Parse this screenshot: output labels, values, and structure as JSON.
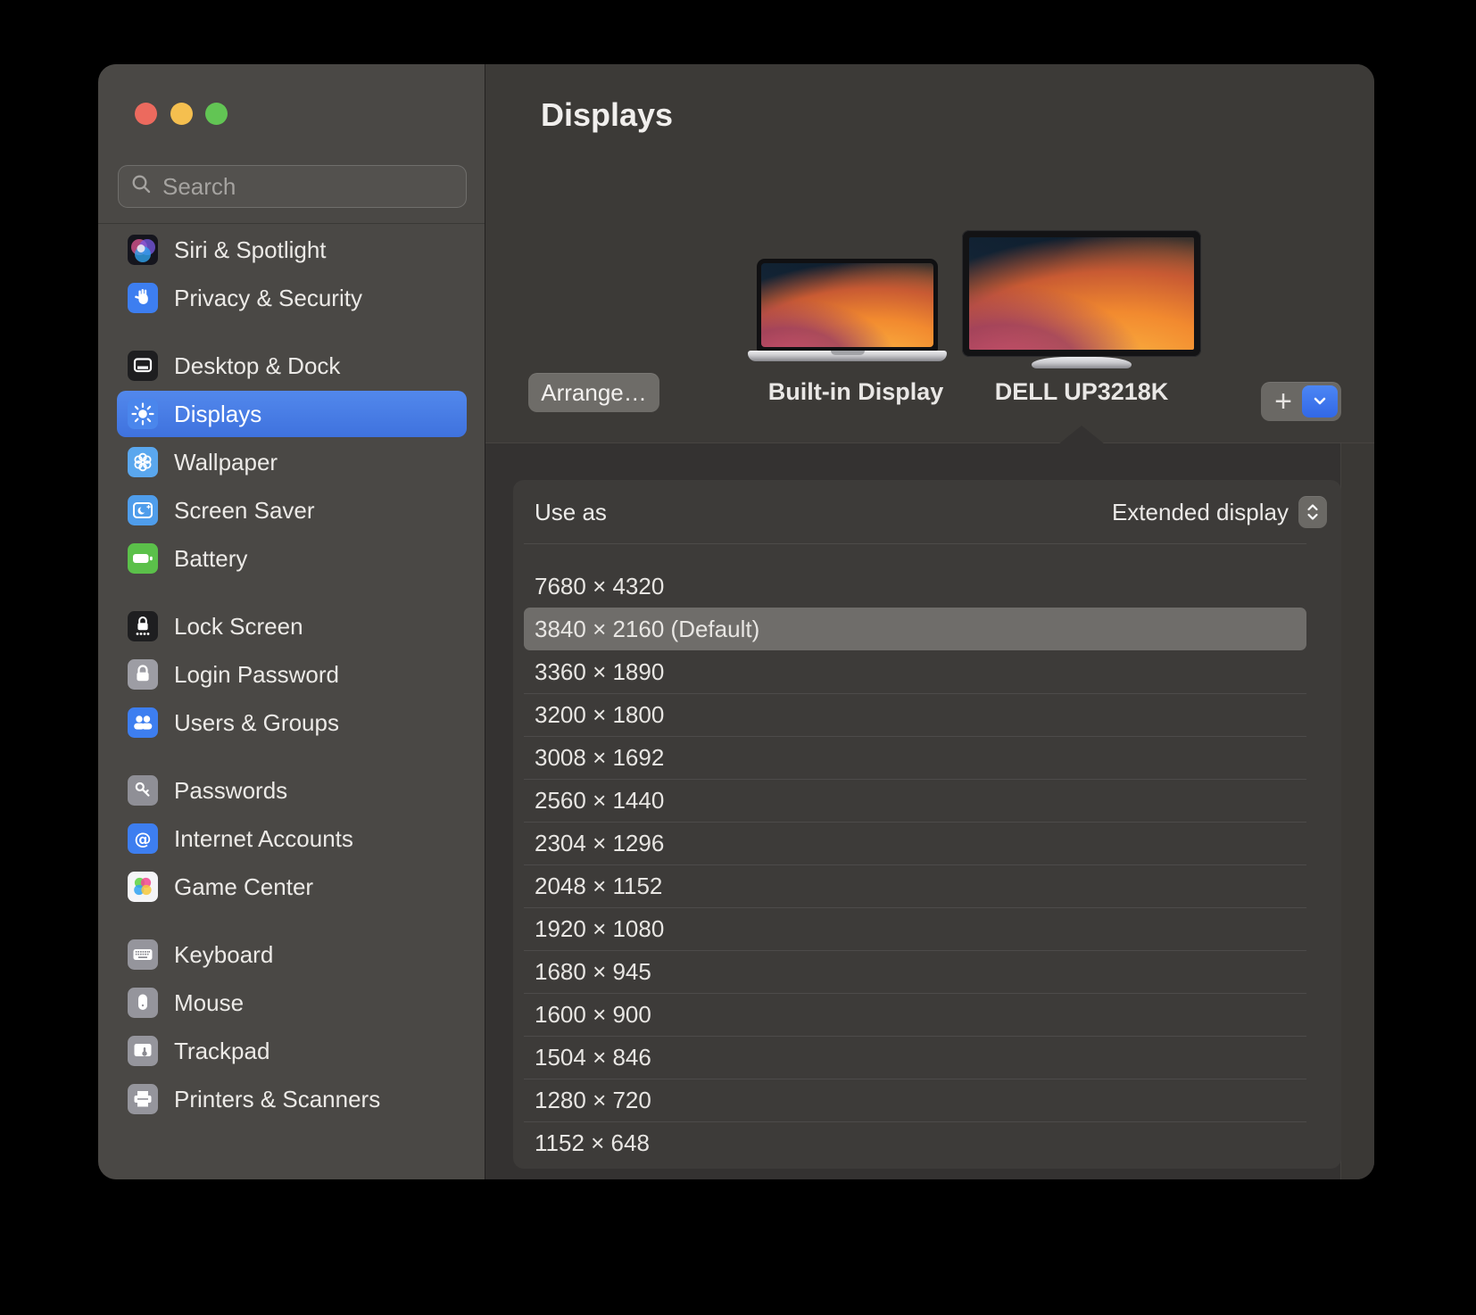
{
  "sidebar": {
    "search_placeholder": "Search",
    "groups": [
      {
        "items": [
          {
            "label": "Siri & Spotlight",
            "icon": "siri-icon"
          },
          {
            "label": "Privacy & Security",
            "icon": "privacy-icon"
          }
        ]
      },
      {
        "items": [
          {
            "label": "Desktop & Dock",
            "icon": "desktop-dock-icon"
          },
          {
            "label": "Displays",
            "icon": "displays-icon",
            "selected": true
          },
          {
            "label": "Wallpaper",
            "icon": "wallpaper-icon"
          },
          {
            "label": "Screen Saver",
            "icon": "screen-saver-icon"
          },
          {
            "label": "Battery",
            "icon": "battery-icon"
          }
        ]
      },
      {
        "items": [
          {
            "label": "Lock Screen",
            "icon": "lock-screen-icon"
          },
          {
            "label": "Login Password",
            "icon": "login-password-icon"
          },
          {
            "label": "Users & Groups",
            "icon": "users-groups-icon"
          }
        ]
      },
      {
        "items": [
          {
            "label": "Passwords",
            "icon": "passwords-icon"
          },
          {
            "label": "Internet Accounts",
            "icon": "internet-accounts-icon"
          },
          {
            "label": "Game Center",
            "icon": "game-center-icon"
          }
        ]
      },
      {
        "items": [
          {
            "label": "Keyboard",
            "icon": "keyboard-icon"
          },
          {
            "label": "Mouse",
            "icon": "mouse-icon"
          },
          {
            "label": "Trackpad",
            "icon": "trackpad-icon"
          },
          {
            "label": "Printers & Scanners",
            "icon": "printers-scanners-icon"
          }
        ]
      }
    ]
  },
  "header": {
    "title": "Displays",
    "arrange_button": "Arrange…",
    "displays": [
      {
        "name": "Built-in Display",
        "kind": "laptop"
      },
      {
        "name": "DELL UP3218K",
        "kind": "external-monitor",
        "selected": true
      }
    ],
    "add_button": "+"
  },
  "settings_panel": {
    "use_as_label": "Use as",
    "use_as_value": "Extended display",
    "selected_resolution": "3840 × 2160 (Default)",
    "resolutions": [
      {
        "label": "7680 × 4320"
      },
      {
        "label": "3840 × 2160 (Default)",
        "selected": true
      },
      {
        "label": "3360 × 1890"
      },
      {
        "label": "3200 × 1800"
      },
      {
        "label": "3008 × 1692"
      },
      {
        "label": "2560 × 1440"
      },
      {
        "label": "2304 × 1296"
      },
      {
        "label": "2048 × 1152"
      },
      {
        "label": "1920 × 1080"
      },
      {
        "label": "1680 × 945"
      },
      {
        "label": "1600 × 900"
      },
      {
        "label": "1504 × 846"
      },
      {
        "label": "1280 × 720"
      },
      {
        "label": "1152 × 648"
      }
    ]
  },
  "colors": {
    "accent_blue": "#4a7ce6",
    "selected_row": "#6f6d6a",
    "sidebar_bg": "#4a4845",
    "content_bg": "#343231",
    "panel_bg": "#3d3b39",
    "traffic_red": "#ec6a5e",
    "traffic_yellow": "#f5bf4f",
    "traffic_green": "#62c554"
  }
}
